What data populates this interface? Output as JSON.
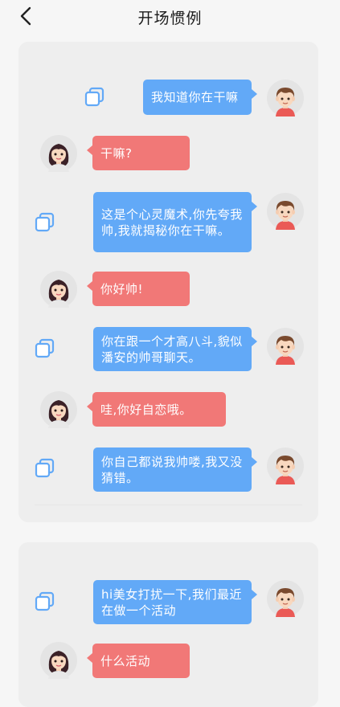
{
  "header": {
    "title": "开场惯例"
  },
  "colors": {
    "blue_bubble": "#62a9f7",
    "red_bubble": "#f17877",
    "card_bg": "#eeeeee"
  },
  "icons": {
    "back": "chevron-left-icon",
    "copy": "copy-icon",
    "male_avatar": "boy-avatar-icon",
    "female_avatar": "girl-avatar-icon"
  },
  "conversations": [
    {
      "messages": [
        {
          "sender": "male",
          "text": "我知道你在干嘛"
        },
        {
          "sender": "female",
          "text": "干嘛?"
        },
        {
          "sender": "male",
          "text": "这是个心灵魔术,你先夸我帅,我就揭秘你在干嘛。"
        },
        {
          "sender": "female",
          "text": "你好帅!"
        },
        {
          "sender": "male",
          "text": "你在跟一个才高八斗,貌似潘安的帅哥聊天。"
        },
        {
          "sender": "female",
          "text": "哇,你好自恋哦。"
        },
        {
          "sender": "male",
          "text": "你自己都说我帅喽,我又没猜错。"
        }
      ]
    },
    {
      "messages": [
        {
          "sender": "male",
          "text": "hi美女打扰一下,我们最近在做一个活动"
        },
        {
          "sender": "female",
          "text": "什么活动"
        }
      ]
    }
  ]
}
